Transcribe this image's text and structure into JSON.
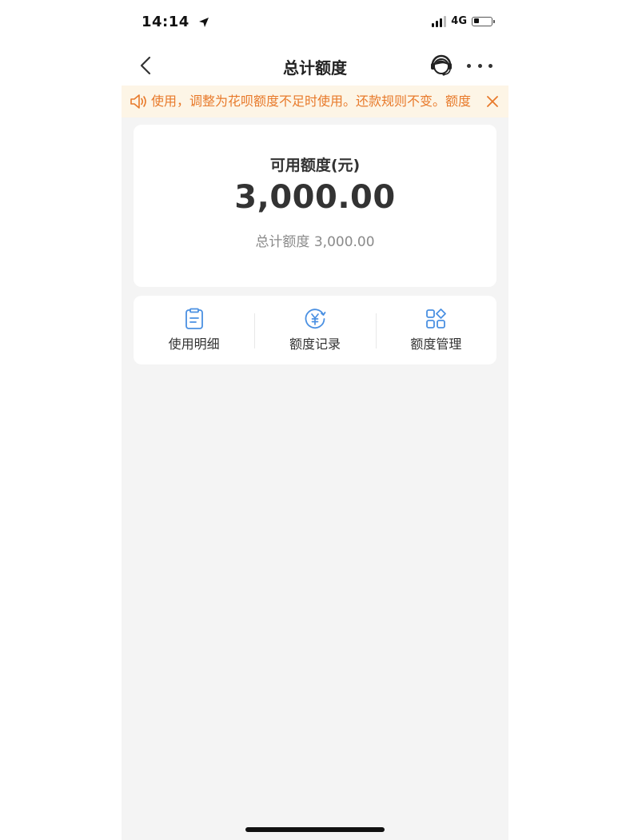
{
  "status_bar": {
    "time": "14:14",
    "network": "4G",
    "battery_percent": 25
  },
  "nav": {
    "title": "总计额度"
  },
  "notice": {
    "text": "使用，调整为花呗额度不足时使用。还款规则不变。额度"
  },
  "balance": {
    "label": "可用额度(元)",
    "amount": "3,000.00",
    "total_label": "总计额度",
    "total_amount": "3,000.00"
  },
  "actions": [
    {
      "label": "使用明细",
      "icon": "document-icon"
    },
    {
      "label": "额度记录",
      "icon": "yuan-circle-icon"
    },
    {
      "label": "额度管理",
      "icon": "grid-manage-icon"
    }
  ],
  "colors": {
    "accent_blue": "#4a90e2",
    "notice_text": "#e87a2b",
    "notice_bg": "#fdf5e6",
    "page_bg": "#f4f4f4"
  }
}
